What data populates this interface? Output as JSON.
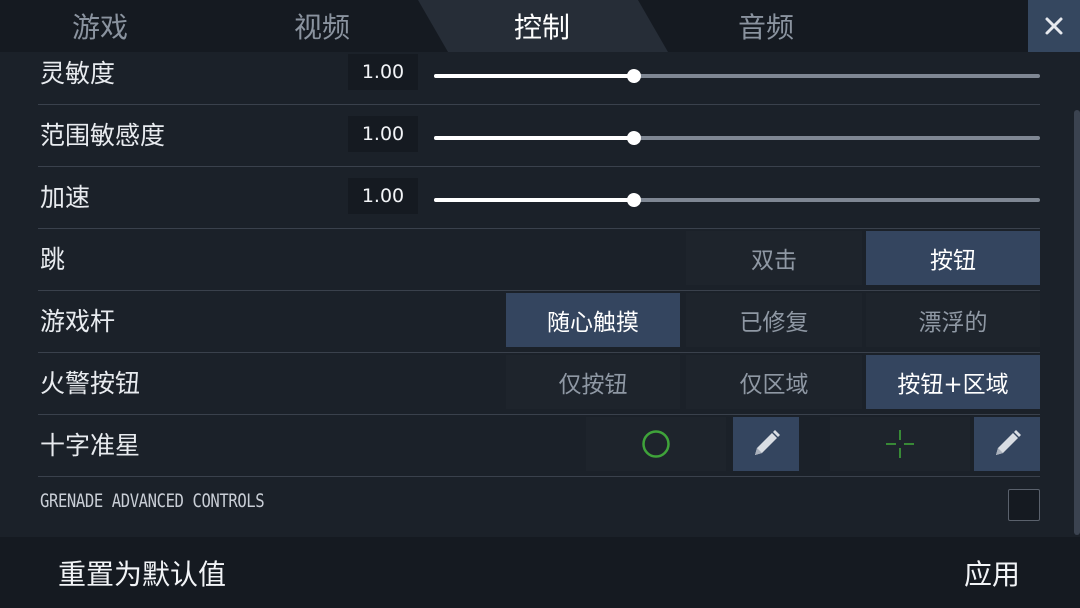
{
  "tabs": [
    {
      "label": "游戏",
      "active": false
    },
    {
      "label": "视频",
      "active": false
    },
    {
      "label": "控制",
      "active": true
    },
    {
      "label": "音频",
      "active": false
    }
  ],
  "close_icon": "close-icon",
  "settings": {
    "sensitivity": {
      "label": "灵敏度",
      "value": "1.00",
      "level": 0.33
    },
    "scope_sensitivity": {
      "label": "范围敏感度",
      "value": "1.00",
      "level": 0.33
    },
    "acceleration": {
      "label": "加速",
      "value": "1.00",
      "level": 0.33
    },
    "jump": {
      "label": "跳",
      "options": [
        "双击",
        "按钮"
      ],
      "selected": "按钮"
    },
    "joystick": {
      "label": "游戏杆",
      "options": [
        "随心触摸",
        "已修复",
        "漂浮的"
      ],
      "selected": "随心触摸"
    },
    "fire_button": {
      "label": "火警按钮",
      "options": [
        "仅按钮",
        "仅区域",
        "按钮+区域"
      ],
      "selected": "按钮+区域"
    },
    "crosshair": {
      "label": "十字准星",
      "primary_icon": "circle-crosshair-icon",
      "secondary_icon": "cross-crosshair-icon",
      "edit_icon": "pencil-icon",
      "color": "#3fa33a"
    },
    "grenade": {
      "label": "GRENADE ADVANCED CONTROLS",
      "checked": false
    }
  },
  "footer": {
    "reset_label": "重置为默认值",
    "apply_label": "应用"
  },
  "colors": {
    "background": "#1b2129",
    "selected": "#34455f",
    "crosshair_green": "#3fa33a"
  }
}
